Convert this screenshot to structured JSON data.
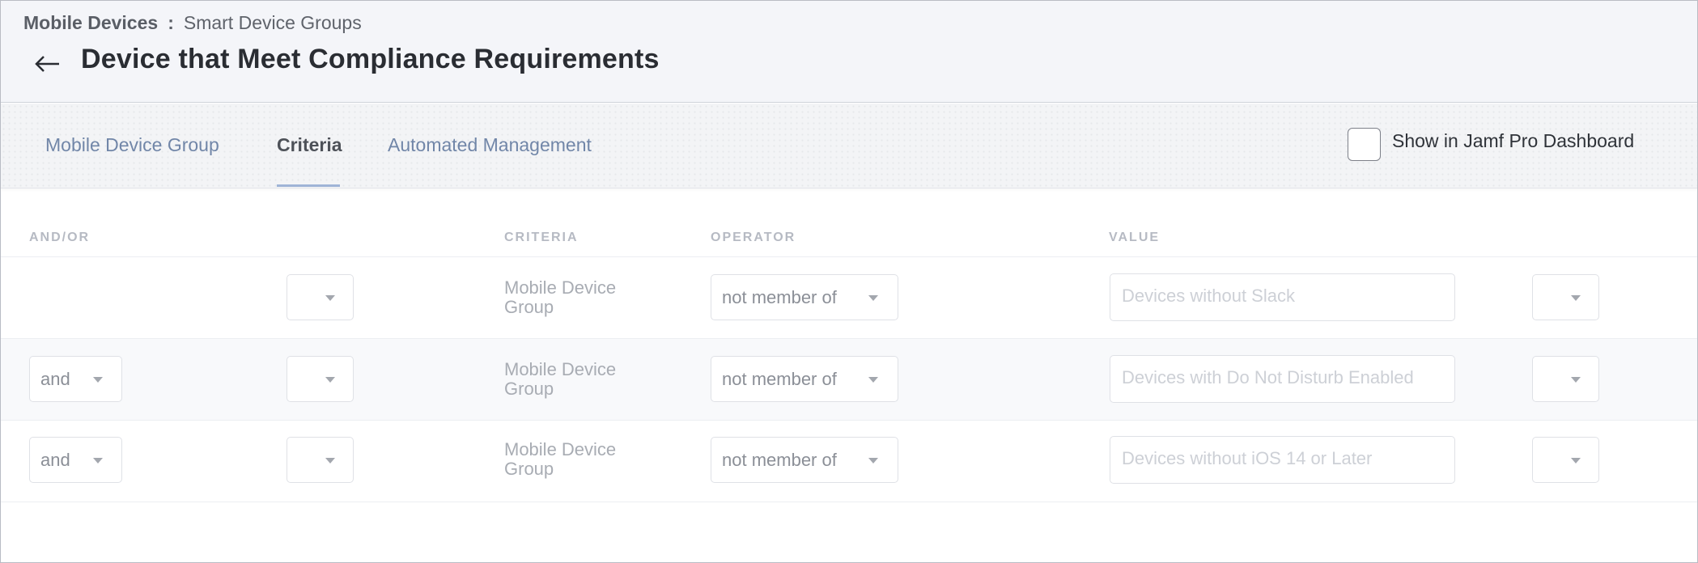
{
  "breadcrumb": {
    "root": "Mobile Devices",
    "separator": ":",
    "current": "Smart Device Groups"
  },
  "page": {
    "title": "Device that Meet Compliance Requirements",
    "back_icon": "arrow-left-icon"
  },
  "tabs": [
    {
      "label": "Mobile Device Group",
      "active": false
    },
    {
      "label": "Criteria",
      "active": true
    },
    {
      "label": "Automated Management",
      "active": false
    }
  ],
  "dashboard_toggle": {
    "label": "Show in Jamf Pro Dashboard",
    "checked": false
  },
  "table": {
    "headers": {
      "and_or": "AND/OR",
      "criteria": "CRITERIA",
      "operator": "OPERATOR",
      "value": "VALUE"
    },
    "rows": [
      {
        "and_or": "",
        "paren_open": "",
        "criteria": "Mobile Device Group",
        "operator": "not member of",
        "value": "Devices without Slack",
        "paren_close": ""
      },
      {
        "and_or": "and",
        "paren_open": "",
        "criteria": "Mobile Device Group",
        "operator": "not member of",
        "value": "Devices with Do Not Disturb Enabled",
        "paren_close": ""
      },
      {
        "and_or": "and",
        "paren_open": "",
        "criteria": "Mobile Device Group",
        "operator": "not member of",
        "value": "Devices without iOS 14 or Later",
        "paren_close": ""
      }
    ]
  },
  "colors": {
    "header_bg": "#f4f5f9",
    "tab_link": "#7186a8",
    "tab_active_underline": "#9fb4d6"
  }
}
